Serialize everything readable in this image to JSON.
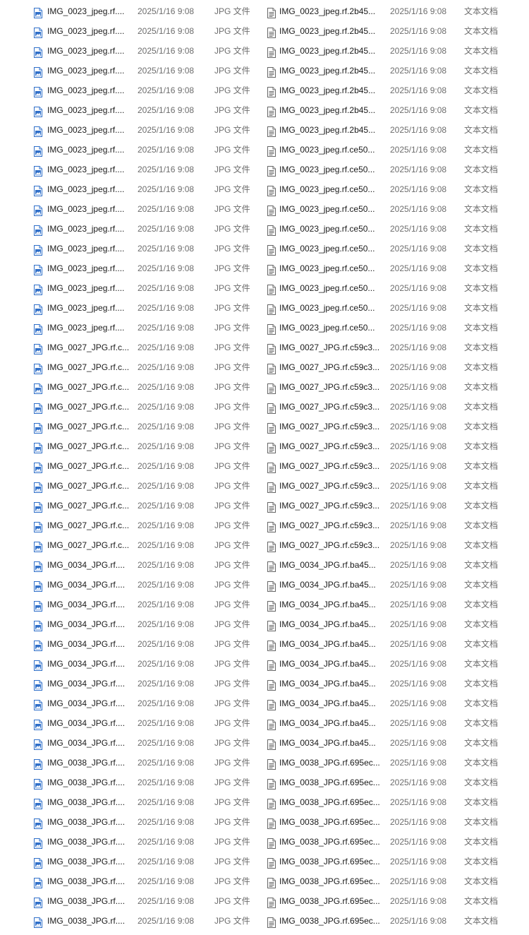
{
  "rows": [
    {
      "left": {
        "name": "IMG_0023_jpeg.rf....",
        "date": "2025/1/16 9:08",
        "type": "JPG 文件"
      },
      "right": {
        "name": "IMG_0023_jpeg.rf.2b45...",
        "date": "2025/1/16 9:08",
        "type": "文本文档"
      }
    },
    {
      "left": {
        "name": "IMG_0023_jpeg.rf....",
        "date": "2025/1/16 9:08",
        "type": "JPG 文件"
      },
      "right": {
        "name": "IMG_0023_jpeg.rf.2b45...",
        "date": "2025/1/16 9:08",
        "type": "文本文档"
      }
    },
    {
      "left": {
        "name": "IMG_0023_jpeg.rf....",
        "date": "2025/1/16 9:08",
        "type": "JPG 文件"
      },
      "right": {
        "name": "IMG_0023_jpeg.rf.2b45...",
        "date": "2025/1/16 9:08",
        "type": "文本文档"
      }
    },
    {
      "left": {
        "name": "IMG_0023_jpeg.rf....",
        "date": "2025/1/16 9:08",
        "type": "JPG 文件"
      },
      "right": {
        "name": "IMG_0023_jpeg.rf.2b45...",
        "date": "2025/1/16 9:08",
        "type": "文本文档"
      }
    },
    {
      "left": {
        "name": "IMG_0023_jpeg.rf....",
        "date": "2025/1/16 9:08",
        "type": "JPG 文件"
      },
      "right": {
        "name": "IMG_0023_jpeg.rf.2b45...",
        "date": "2025/1/16 9:08",
        "type": "文本文档"
      }
    },
    {
      "left": {
        "name": "IMG_0023_jpeg.rf....",
        "date": "2025/1/16 9:08",
        "type": "JPG 文件"
      },
      "right": {
        "name": "IMG_0023_jpeg.rf.2b45...",
        "date": "2025/1/16 9:08",
        "type": "文本文档"
      }
    },
    {
      "left": {
        "name": "IMG_0023_jpeg.rf....",
        "date": "2025/1/16 9:08",
        "type": "JPG 文件"
      },
      "right": {
        "name": "IMG_0023_jpeg.rf.2b45...",
        "date": "2025/1/16 9:08",
        "type": "文本文档"
      }
    },
    {
      "left": {
        "name": "IMG_0023_jpeg.rf....",
        "date": "2025/1/16 9:08",
        "type": "JPG 文件"
      },
      "right": {
        "name": "IMG_0023_jpeg.rf.ce50...",
        "date": "2025/1/16 9:08",
        "type": "文本文档"
      }
    },
    {
      "left": {
        "name": "IMG_0023_jpeg.rf....",
        "date": "2025/1/16 9:08",
        "type": "JPG 文件"
      },
      "right": {
        "name": "IMG_0023_jpeg.rf.ce50...",
        "date": "2025/1/16 9:08",
        "type": "文本文档"
      }
    },
    {
      "left": {
        "name": "IMG_0023_jpeg.rf....",
        "date": "2025/1/16 9:08",
        "type": "JPG 文件"
      },
      "right": {
        "name": "IMG_0023_jpeg.rf.ce50...",
        "date": "2025/1/16 9:08",
        "type": "文本文档"
      }
    },
    {
      "left": {
        "name": "IMG_0023_jpeg.rf....",
        "date": "2025/1/16 9:08",
        "type": "JPG 文件"
      },
      "right": {
        "name": "IMG_0023_jpeg.rf.ce50...",
        "date": "2025/1/16 9:08",
        "type": "文本文档"
      }
    },
    {
      "left": {
        "name": "IMG_0023_jpeg.rf....",
        "date": "2025/1/16 9:08",
        "type": "JPG 文件"
      },
      "right": {
        "name": "IMG_0023_jpeg.rf.ce50...",
        "date": "2025/1/16 9:08",
        "type": "文本文档"
      }
    },
    {
      "left": {
        "name": "IMG_0023_jpeg.rf....",
        "date": "2025/1/16 9:08",
        "type": "JPG 文件"
      },
      "right": {
        "name": "IMG_0023_jpeg.rf.ce50...",
        "date": "2025/1/16 9:08",
        "type": "文本文档"
      }
    },
    {
      "left": {
        "name": "IMG_0023_jpeg.rf....",
        "date": "2025/1/16 9:08",
        "type": "JPG 文件"
      },
      "right": {
        "name": "IMG_0023_jpeg.rf.ce50...",
        "date": "2025/1/16 9:08",
        "type": "文本文档"
      }
    },
    {
      "left": {
        "name": "IMG_0023_jpeg.rf....",
        "date": "2025/1/16 9:08",
        "type": "JPG 文件"
      },
      "right": {
        "name": "IMG_0023_jpeg.rf.ce50...",
        "date": "2025/1/16 9:08",
        "type": "文本文档"
      }
    },
    {
      "left": {
        "name": "IMG_0023_jpeg.rf....",
        "date": "2025/1/16 9:08",
        "type": "JPG 文件"
      },
      "right": {
        "name": "IMG_0023_jpeg.rf.ce50...",
        "date": "2025/1/16 9:08",
        "type": "文本文档"
      }
    },
    {
      "left": {
        "name": "IMG_0023_jpeg.rf....",
        "date": "2025/1/16 9:08",
        "type": "JPG 文件"
      },
      "right": {
        "name": "IMG_0023_jpeg.rf.ce50...",
        "date": "2025/1/16 9:08",
        "type": "文本文档"
      }
    },
    {
      "left": {
        "name": "IMG_0027_JPG.rf.c...",
        "date": "2025/1/16 9:08",
        "type": "JPG 文件"
      },
      "right": {
        "name": "IMG_0027_JPG.rf.c59c3...",
        "date": "2025/1/16 9:08",
        "type": "文本文档"
      }
    },
    {
      "left": {
        "name": "IMG_0027_JPG.rf.c...",
        "date": "2025/1/16 9:08",
        "type": "JPG 文件"
      },
      "right": {
        "name": "IMG_0027_JPG.rf.c59c3...",
        "date": "2025/1/16 9:08",
        "type": "文本文档"
      }
    },
    {
      "left": {
        "name": "IMG_0027_JPG.rf.c...",
        "date": "2025/1/16 9:08",
        "type": "JPG 文件"
      },
      "right": {
        "name": "IMG_0027_JPG.rf.c59c3...",
        "date": "2025/1/16 9:08",
        "type": "文本文档"
      }
    },
    {
      "left": {
        "name": "IMG_0027_JPG.rf.c...",
        "date": "2025/1/16 9:08",
        "type": "JPG 文件"
      },
      "right": {
        "name": "IMG_0027_JPG.rf.c59c3...",
        "date": "2025/1/16 9:08",
        "type": "文本文档"
      }
    },
    {
      "left": {
        "name": "IMG_0027_JPG.rf.c...",
        "date": "2025/1/16 9:08",
        "type": "JPG 文件"
      },
      "right": {
        "name": "IMG_0027_JPG.rf.c59c3...",
        "date": "2025/1/16 9:08",
        "type": "文本文档"
      }
    },
    {
      "left": {
        "name": "IMG_0027_JPG.rf.c...",
        "date": "2025/1/16 9:08",
        "type": "JPG 文件"
      },
      "right": {
        "name": "IMG_0027_JPG.rf.c59c3...",
        "date": "2025/1/16 9:08",
        "type": "文本文档"
      }
    },
    {
      "left": {
        "name": "IMG_0027_JPG.rf.c...",
        "date": "2025/1/16 9:08",
        "type": "JPG 文件"
      },
      "right": {
        "name": "IMG_0027_JPG.rf.c59c3...",
        "date": "2025/1/16 9:08",
        "type": "文本文档"
      }
    },
    {
      "left": {
        "name": "IMG_0027_JPG.rf.c...",
        "date": "2025/1/16 9:08",
        "type": "JPG 文件"
      },
      "right": {
        "name": "IMG_0027_JPG.rf.c59c3...",
        "date": "2025/1/16 9:08",
        "type": "文本文档"
      }
    },
    {
      "left": {
        "name": "IMG_0027_JPG.rf.c...",
        "date": "2025/1/16 9:08",
        "type": "JPG 文件"
      },
      "right": {
        "name": "IMG_0027_JPG.rf.c59c3...",
        "date": "2025/1/16 9:08",
        "type": "文本文档"
      }
    },
    {
      "left": {
        "name": "IMG_0027_JPG.rf.c...",
        "date": "2025/1/16 9:08",
        "type": "JPG 文件"
      },
      "right": {
        "name": "IMG_0027_JPG.rf.c59c3...",
        "date": "2025/1/16 9:08",
        "type": "文本文档"
      }
    },
    {
      "left": {
        "name": "IMG_0027_JPG.rf.c...",
        "date": "2025/1/16 9:08",
        "type": "JPG 文件"
      },
      "right": {
        "name": "IMG_0027_JPG.rf.c59c3...",
        "date": "2025/1/16 9:08",
        "type": "文本文档"
      }
    },
    {
      "left": {
        "name": "IMG_0034_JPG.rf....",
        "date": "2025/1/16 9:08",
        "type": "JPG 文件"
      },
      "right": {
        "name": "IMG_0034_JPG.rf.ba45...",
        "date": "2025/1/16 9:08",
        "type": "文本文档"
      }
    },
    {
      "left": {
        "name": "IMG_0034_JPG.rf....",
        "date": "2025/1/16 9:08",
        "type": "JPG 文件"
      },
      "right": {
        "name": "IMG_0034_JPG.rf.ba45...",
        "date": "2025/1/16 9:08",
        "type": "文本文档"
      }
    },
    {
      "left": {
        "name": "IMG_0034_JPG.rf....",
        "date": "2025/1/16 9:08",
        "type": "JPG 文件"
      },
      "right": {
        "name": "IMG_0034_JPG.rf.ba45...",
        "date": "2025/1/16 9:08",
        "type": "文本文档"
      }
    },
    {
      "left": {
        "name": "IMG_0034_JPG.rf....",
        "date": "2025/1/16 9:08",
        "type": "JPG 文件"
      },
      "right": {
        "name": "IMG_0034_JPG.rf.ba45...",
        "date": "2025/1/16 9:08",
        "type": "文本文档"
      }
    },
    {
      "left": {
        "name": "IMG_0034_JPG.rf....",
        "date": "2025/1/16 9:08",
        "type": "JPG 文件"
      },
      "right": {
        "name": "IMG_0034_JPG.rf.ba45...",
        "date": "2025/1/16 9:08",
        "type": "文本文档"
      }
    },
    {
      "left": {
        "name": "IMG_0034_JPG.rf....",
        "date": "2025/1/16 9:08",
        "type": "JPG 文件"
      },
      "right": {
        "name": "IMG_0034_JPG.rf.ba45...",
        "date": "2025/1/16 9:08",
        "type": "文本文档"
      }
    },
    {
      "left": {
        "name": "IMG_0034_JPG.rf....",
        "date": "2025/1/16 9:08",
        "type": "JPG 文件"
      },
      "right": {
        "name": "IMG_0034_JPG.rf.ba45...",
        "date": "2025/1/16 9:08",
        "type": "文本文档"
      }
    },
    {
      "left": {
        "name": "IMG_0034_JPG.rf....",
        "date": "2025/1/16 9:08",
        "type": "JPG 文件"
      },
      "right": {
        "name": "IMG_0034_JPG.rf.ba45...",
        "date": "2025/1/16 9:08",
        "type": "文本文档"
      }
    },
    {
      "left": {
        "name": "IMG_0034_JPG.rf....",
        "date": "2025/1/16 9:08",
        "type": "JPG 文件"
      },
      "right": {
        "name": "IMG_0034_JPG.rf.ba45...",
        "date": "2025/1/16 9:08",
        "type": "文本文档"
      }
    },
    {
      "left": {
        "name": "IMG_0034_JPG.rf....",
        "date": "2025/1/16 9:08",
        "type": "JPG 文件"
      },
      "right": {
        "name": "IMG_0034_JPG.rf.ba45...",
        "date": "2025/1/16 9:08",
        "type": "文本文档"
      }
    },
    {
      "left": {
        "name": "IMG_0038_JPG.rf....",
        "date": "2025/1/16 9:08",
        "type": "JPG 文件"
      },
      "right": {
        "name": "IMG_0038_JPG.rf.695ec...",
        "date": "2025/1/16 9:08",
        "type": "文本文档"
      }
    },
    {
      "left": {
        "name": "IMG_0038_JPG.rf....",
        "date": "2025/1/16 9:08",
        "type": "JPG 文件"
      },
      "right": {
        "name": "IMG_0038_JPG.rf.695ec...",
        "date": "2025/1/16 9:08",
        "type": "文本文档"
      }
    },
    {
      "left": {
        "name": "IMG_0038_JPG.rf....",
        "date": "2025/1/16 9:08",
        "type": "JPG 文件"
      },
      "right": {
        "name": "IMG_0038_JPG.rf.695ec...",
        "date": "2025/1/16 9:08",
        "type": "文本文档"
      }
    },
    {
      "left": {
        "name": "IMG_0038_JPG.rf....",
        "date": "2025/1/16 9:08",
        "type": "JPG 文件"
      },
      "right": {
        "name": "IMG_0038_JPG.rf.695ec...",
        "date": "2025/1/16 9:08",
        "type": "文本文档"
      }
    },
    {
      "left": {
        "name": "IMG_0038_JPG.rf....",
        "date": "2025/1/16 9:08",
        "type": "JPG 文件"
      },
      "right": {
        "name": "IMG_0038_JPG.rf.695ec...",
        "date": "2025/1/16 9:08",
        "type": "文本文档"
      }
    },
    {
      "left": {
        "name": "IMG_0038_JPG.rf....",
        "date": "2025/1/16 9:08",
        "type": "JPG 文件"
      },
      "right": {
        "name": "IMG_0038_JPG.rf.695ec...",
        "date": "2025/1/16 9:08",
        "type": "文本文档"
      }
    },
    {
      "left": {
        "name": "IMG_0038_JPG.rf....",
        "date": "2025/1/16 9:08",
        "type": "JPG 文件"
      },
      "right": {
        "name": "IMG_0038_JPG.rf.695ec...",
        "date": "2025/1/16 9:08",
        "type": "文本文档"
      }
    },
    {
      "left": {
        "name": "IMG_0038_JPG.rf....",
        "date": "2025/1/16 9:08",
        "type": "JPG 文件"
      },
      "right": {
        "name": "IMG_0038_JPG.rf.695ec...",
        "date": "2025/1/16 9:08",
        "type": "文本文档"
      }
    },
    {
      "left": {
        "name": "IMG_0038_JPG.rf....",
        "date": "2025/1/16 9:08",
        "type": "JPG 文件"
      },
      "right": {
        "name": "IMG_0038_JPG.rf.695ec...",
        "date": "2025/1/16 9:08",
        "type": "文本文档"
      }
    }
  ],
  "icons": {
    "left": "jpg-file-icon",
    "right": "text-document-icon"
  },
  "colors": {
    "name_text": "#1a1a1a",
    "meta_text": "#6d6d6d",
    "icon_blue": "#2f6fc9",
    "icon_grey": "#666666"
  }
}
